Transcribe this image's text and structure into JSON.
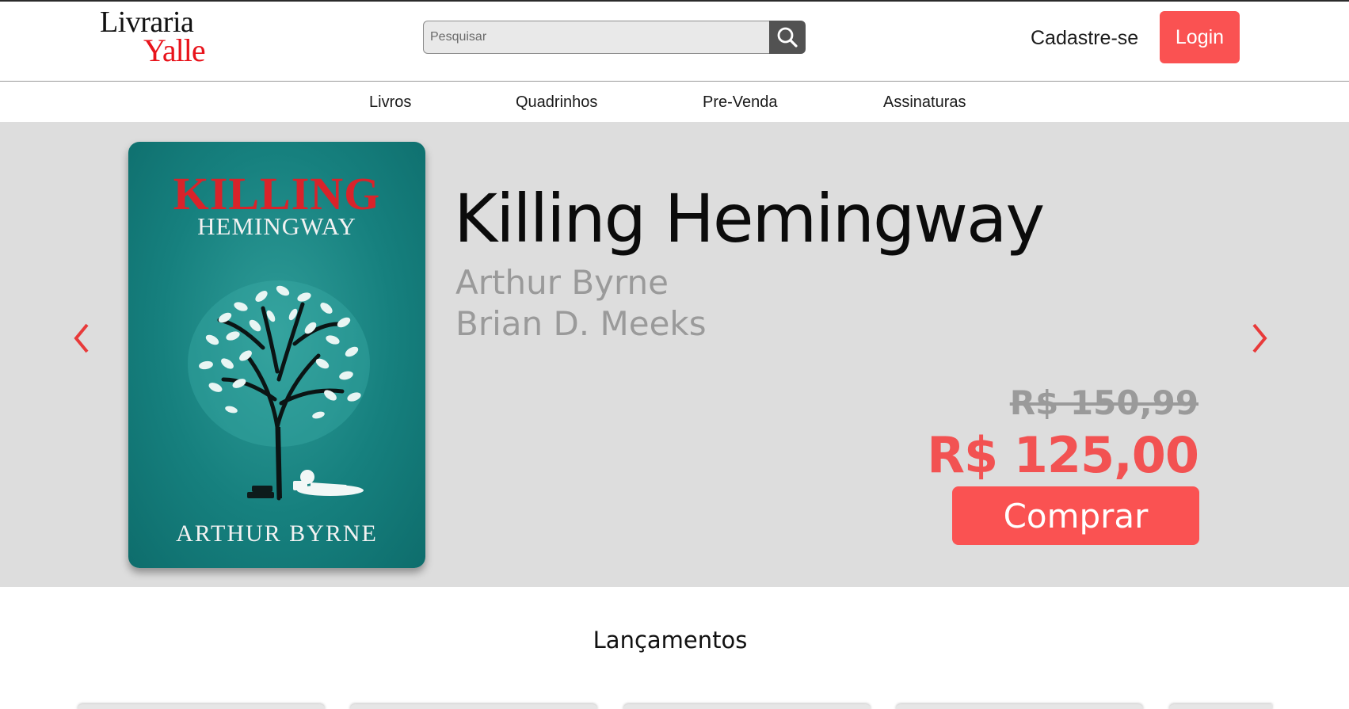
{
  "brand": {
    "name_line1": "Livraria",
    "name_line2": "Yalle",
    "accent_color": "#fa5252",
    "logo_red": "#e8131b"
  },
  "search": {
    "placeholder": "Pesquisar",
    "icon": "search-icon"
  },
  "header": {
    "signup_label": "Cadastre-se",
    "login_label": "Login"
  },
  "nav": {
    "items": [
      {
        "label": "Livros"
      },
      {
        "label": "Quadrinhos"
      },
      {
        "label": "Pre-Venda"
      },
      {
        "label": "Assinaturas"
      }
    ]
  },
  "featured": {
    "cover": {
      "title_line1": "KILLING",
      "title_line2": "HEMINGWAY",
      "author": "ARTHUR BYRNE"
    },
    "title": "Killing Hemingway",
    "authors": [
      "Arthur Byrne",
      "Brian D. Meeks"
    ],
    "old_price": "R$ 150,99",
    "new_price": "R$ 125,00",
    "buy_label": "Comprar",
    "prev_icon": "chevron-left-icon",
    "next_icon": "chevron-right-icon"
  },
  "releases": {
    "title": "Lançamentos"
  }
}
